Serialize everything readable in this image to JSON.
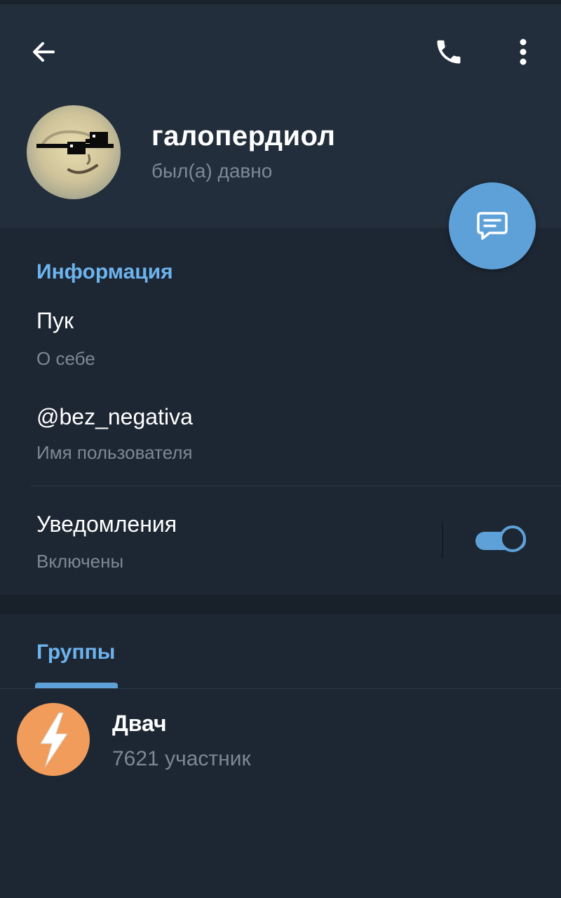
{
  "header": {
    "icons": {
      "back": "arrow-left-icon",
      "call": "phone-icon",
      "more": "more-vertical-icon",
      "message": "message-icon"
    },
    "name": "галопердиол",
    "status": "был(а) давно"
  },
  "info": {
    "title": "Информация",
    "bio": {
      "value": "Пук",
      "label": "О себе"
    },
    "username": {
      "value": "@bez_negativa",
      "label": "Имя пользователя"
    },
    "notifications": {
      "value": "Уведомления",
      "label": "Включены",
      "enabled": true
    }
  },
  "groups": {
    "title": "Группы",
    "items": [
      {
        "name": "Двач",
        "members": "7621 участник",
        "icon": "lightning-icon"
      }
    ]
  },
  "colors": {
    "accent": "#5ea1d9",
    "section_title": "#6db3ee",
    "header_bg": "#222e3b",
    "body_bg": "#1d2733",
    "group_avatar": "#f19c5a"
  }
}
